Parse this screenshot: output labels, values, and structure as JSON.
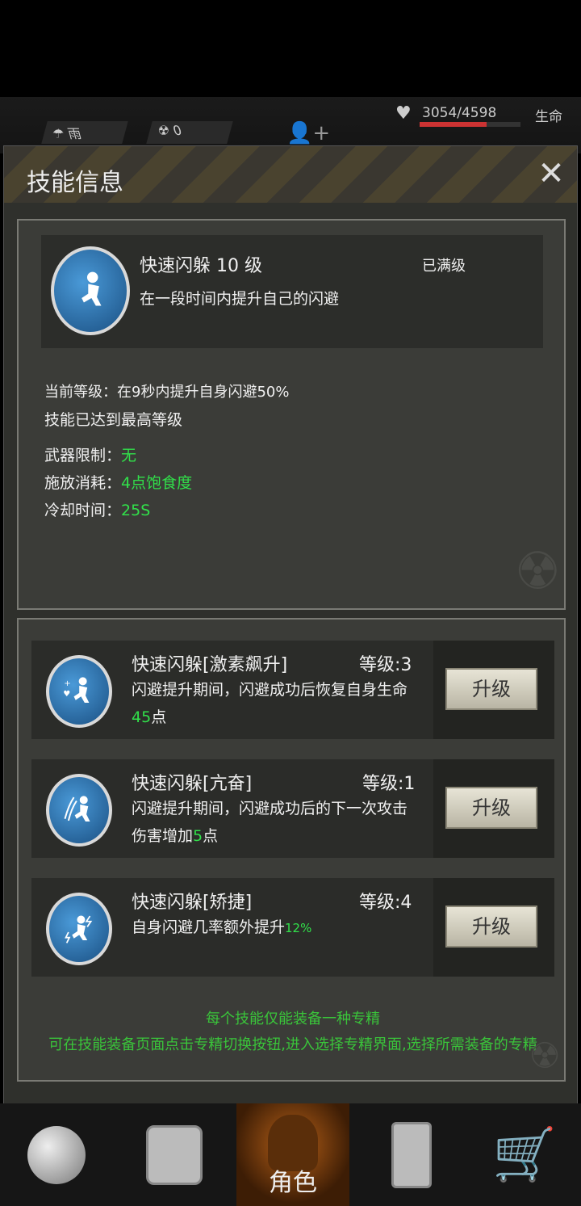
{
  "status": {
    "weather": "雨",
    "radiation": "0",
    "hp": "3054/4598",
    "hp_label": "生命",
    "hp_fraction": 0.664
  },
  "modal": {
    "title": "技能信息",
    "close": "✕"
  },
  "skill": {
    "name": "快速闪躲",
    "level": "10 级",
    "status": "已满级",
    "description": "在一段时间内提升自己的闪避",
    "current_label": "当前等级：在9秒内提升自身闪避50%",
    "max_text": "技能已达到最高等级",
    "weapon_label": "武器限制：",
    "weapon_value": "无",
    "cost_label": "施放消耗：",
    "cost_value": "4点饱食度",
    "cooldown_label": "冷却时间：",
    "cooldown_value": "25S"
  },
  "specializations": [
    {
      "name": "快速闪躲[激素飙升]",
      "level": "等级:3",
      "desc_a": "闪避提升期间，闪避成功后恢复自身生命",
      "desc_value": "45",
      "desc_b": "点",
      "button": "升级"
    },
    {
      "name": "快速闪躲[亢奋]",
      "level": "等级:1",
      "desc_a": "闪避提升期间，闪避成功后的下一次攻击",
      "desc_c": "伤害增加",
      "desc_value": "5",
      "desc_b": "点",
      "button": "升级"
    },
    {
      "name": "快速闪躲[矫捷]",
      "level": "等级:4",
      "desc_a": "自身闪避几率额外提升",
      "desc_value": "12%",
      "button": "升级"
    }
  ],
  "notes": {
    "line1": "每个技能仅能装备一种专精",
    "line2": "可在技能装备页面点击专精切换按钮,进入选择专精界面,选择所需装备的专精"
  },
  "nav": {
    "active_label": "角色",
    "items": [
      "globe-icon",
      "backpack-icon",
      "character-icon",
      "radio-icon",
      "cart-icon"
    ]
  }
}
